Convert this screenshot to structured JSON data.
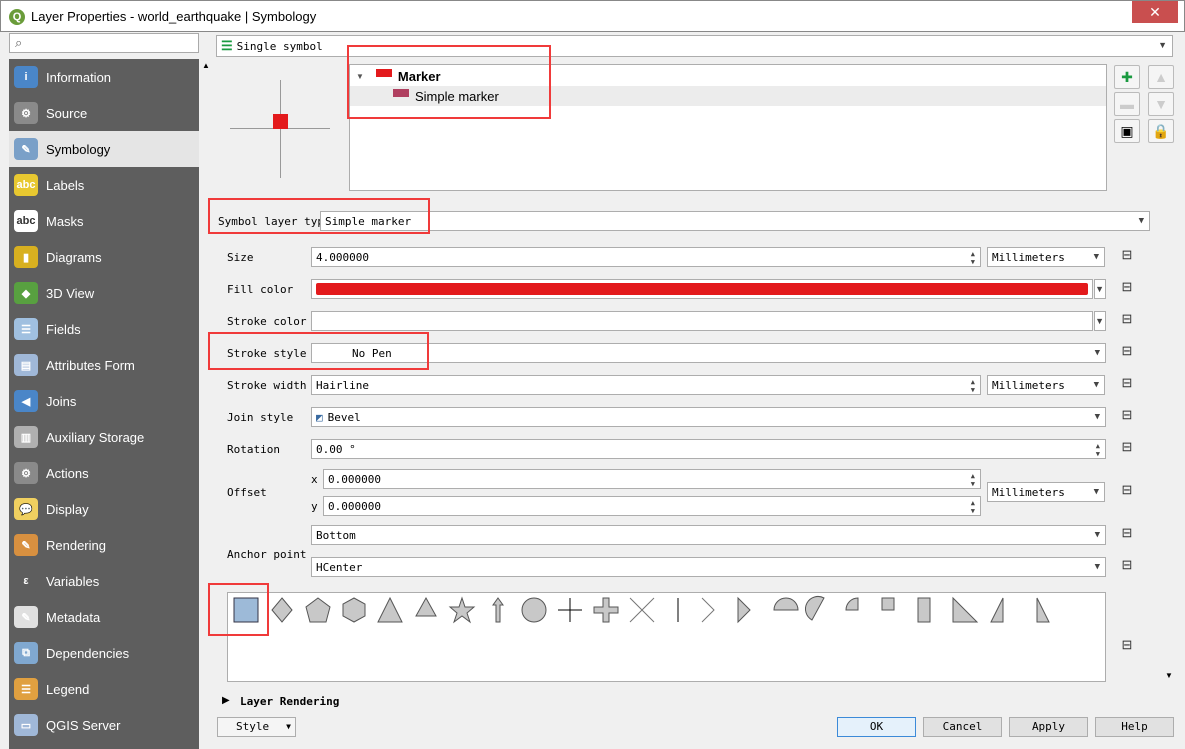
{
  "window": {
    "title": "Layer Properties - world_earthquake | Symbology",
    "close": "✕"
  },
  "sidebar": {
    "items": [
      {
        "label": "Information",
        "icon": "info-icon",
        "color": "#4a86c8",
        "glyph": "i"
      },
      {
        "label": "Source",
        "icon": "wrench-icon",
        "color": "#8a8a8a",
        "glyph": "⚙"
      },
      {
        "label": "Symbology",
        "icon": "paintbrush-icon",
        "color": "#7aa0c8",
        "glyph": "✎"
      },
      {
        "label": "Labels",
        "icon": "labels-icon",
        "color": "#e8c830",
        "glyph": "abc"
      },
      {
        "label": "Masks",
        "icon": "masks-icon",
        "color": "#ffffff",
        "glyph": "abc"
      },
      {
        "label": "Diagrams",
        "icon": "diagrams-icon",
        "color": "#d8b020",
        "glyph": "▮"
      },
      {
        "label": "3D View",
        "icon": "cube-icon",
        "color": "#58a040",
        "glyph": "◆"
      },
      {
        "label": "Fields",
        "icon": "fields-icon",
        "color": "#a0c0e0",
        "glyph": "☰"
      },
      {
        "label": "Attributes Form",
        "icon": "form-icon",
        "color": "#a0b8d8",
        "glyph": "▤"
      },
      {
        "label": "Joins",
        "icon": "joins-icon",
        "color": "#4a86c8",
        "glyph": "◀"
      },
      {
        "label": "Auxiliary Storage",
        "icon": "database-icon",
        "color": "#b0b0b0",
        "glyph": "▥"
      },
      {
        "label": "Actions",
        "icon": "actions-icon",
        "color": "#8a8a8a",
        "glyph": "⚙"
      },
      {
        "label": "Display",
        "icon": "display-icon",
        "color": "#f0d060",
        "glyph": "💬"
      },
      {
        "label": "Rendering",
        "icon": "rendering-icon",
        "color": "#d89040",
        "glyph": "✎"
      },
      {
        "label": "Variables",
        "icon": "variables-icon",
        "color": "#5e5e5e",
        "glyph": "ε"
      },
      {
        "label": "Metadata",
        "icon": "metadata-icon",
        "color": "#e0e0e0",
        "glyph": "✎"
      },
      {
        "label": "Dependencies",
        "icon": "dependencies-icon",
        "color": "#80a8d0",
        "glyph": "⧉"
      },
      {
        "label": "Legend",
        "icon": "legend-icon",
        "color": "#e0a040",
        "glyph": "☰"
      },
      {
        "label": "QGIS Server",
        "icon": "server-icon",
        "color": "#a0b8d8",
        "glyph": "▭"
      }
    ],
    "selected": "Symbology"
  },
  "renderer": {
    "value": "Single symbol"
  },
  "tree": {
    "root": "Marker",
    "child": "Simple marker",
    "root_color": "#e31a1c",
    "child_color": "#b04060"
  },
  "symbol_layer_type": {
    "label": "Symbol layer type",
    "value": "Simple marker"
  },
  "props": {
    "size": {
      "label": "Size",
      "value": "4.000000",
      "unit": "Millimeters"
    },
    "fill_color": {
      "label": "Fill color",
      "color": "#e31a1c"
    },
    "stroke_color": {
      "label": "Stroke color",
      "color": "#ffffff"
    },
    "stroke_style": {
      "label": "Stroke style",
      "value": "No Pen"
    },
    "stroke_width": {
      "label": "Stroke width",
      "value": "Hairline",
      "unit": "Millimeters"
    },
    "join_style": {
      "label": "Join style",
      "value": "Bevel"
    },
    "rotation": {
      "label": "Rotation",
      "value": "0.00 °"
    },
    "offset": {
      "label": "Offset",
      "x_label": "x",
      "x": "0.000000",
      "y_label": "y",
      "y": "0.000000",
      "unit": "Millimeters"
    },
    "anchor": {
      "label": "Anchor point",
      "vertical": "Bottom",
      "horizontal": "HCenter"
    }
  },
  "shapes": [
    "square",
    "diamond",
    "pentagon",
    "hexagon",
    "triangle",
    "equilateral-triangle",
    "star",
    "arrow",
    "circle",
    "cross",
    "cross-fill",
    "x",
    "line",
    "arrowhead",
    "filled-arrowhead",
    "semicircle",
    "third-circle",
    "quarter-circle",
    "quarter-square",
    "half-square",
    "diagonal-half-square",
    "right-half-triangle",
    "left-half-triangle"
  ],
  "selected_shape": "square",
  "layer_rendering": "Layer Rendering",
  "footer": {
    "style": "Style",
    "ok": "OK",
    "cancel": "Cancel",
    "apply": "Apply",
    "help": "Help"
  }
}
